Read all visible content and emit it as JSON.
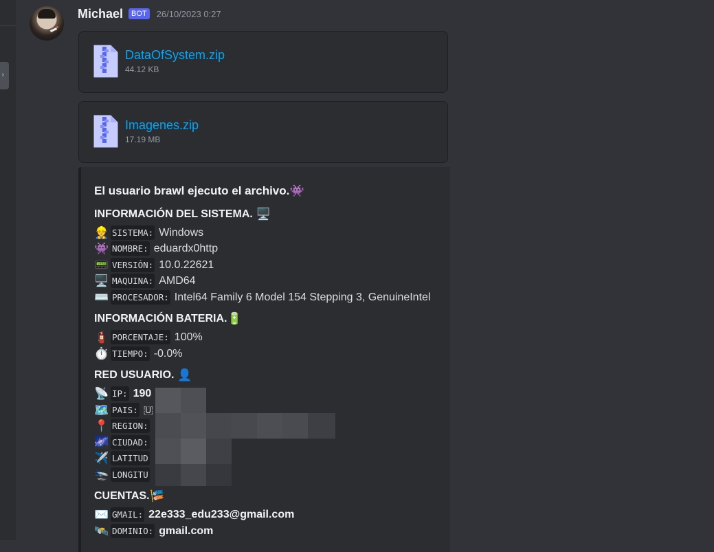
{
  "message": {
    "author": "Michael",
    "badge": "BOT",
    "timestamp": "26/10/2023 0:27"
  },
  "attachments": [
    {
      "name": "DataOfSystem.zip",
      "size": "44.12 KB",
      "icon": "zip-file-icon"
    },
    {
      "name": "Imagenes.zip",
      "size": "17.19 MB",
      "icon": "zip-file-icon"
    }
  ],
  "embed": {
    "title": "El usuario brawl ejecuto el archivo.",
    "title_emoji": "👾",
    "system": {
      "heading": "INFORMACIÓN DEL SISTEMA.",
      "heading_emoji": "🖥️",
      "rows": [
        {
          "emoji": "👷",
          "key": "SISTEMA:",
          "value": "Windows"
        },
        {
          "emoji": "👾",
          "key": "NOMBRE:",
          "value": "eduardx0http"
        },
        {
          "emoji": "📟",
          "key": "VERSIÓN:",
          "value": "10.0.22621"
        },
        {
          "emoji": "🖥️",
          "key": "MAQUINA:",
          "value": "AMD64"
        },
        {
          "emoji": "⌨️",
          "key": "PROCESADOR:",
          "value": "Intel64 Family 6 Model 154 Stepping 3, GenuineIntel"
        }
      ]
    },
    "battery": {
      "heading": "INFORMACIÓN BATERIA.",
      "heading_emoji": "🔋",
      "rows": [
        {
          "emoji": "🧯",
          "key": "PORCENTAJE:",
          "value": "100%"
        },
        {
          "emoji": "⏱️",
          "key": "TIEMPO:",
          "value": "-0.0%"
        }
      ]
    },
    "network": {
      "heading": "RED USUARIO.",
      "heading_emoji": "👤",
      "rows": [
        {
          "emoji": "📡",
          "key": "IP:",
          "value": "190"
        },
        {
          "emoji": "🗺️",
          "key": "PAIS:",
          "value": "🇺"
        },
        {
          "emoji": "📍",
          "key": "REGION:",
          "value": ""
        },
        {
          "emoji": "🌌",
          "key": "CIUDAD:",
          "value": ""
        },
        {
          "emoji": "✈️",
          "key": "LATITUD",
          "value": ""
        },
        {
          "emoji": "🛬",
          "key": "LONGITU",
          "value": ""
        }
      ]
    },
    "accounts": {
      "heading": "CUENTAS.",
      "heading_emoji": "🎏",
      "rows": [
        {
          "emoji": "✉️",
          "key": "GMAIL:",
          "value": "22e333_edu233@gmail.com"
        },
        {
          "emoji": "🛰️",
          "key": "DOMINIO:",
          "value": "gmail.com"
        }
      ]
    }
  }
}
